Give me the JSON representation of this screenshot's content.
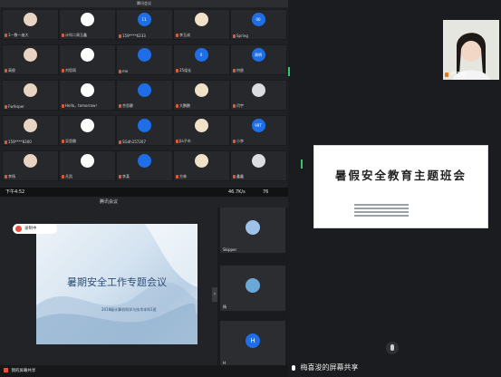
{
  "grid": {
    "title": "腾讯会议",
    "tiles": [
      {
        "label": "1—数—庞大"
      },
      {
        "label": "计科二周玉鑫"
      },
      {
        "label": "159****6233"
      },
      {
        "label": "李玉成"
      },
      {
        "label": "Spring"
      },
      {
        "label": "高俊"
      },
      {
        "label": "刘思雨"
      },
      {
        "label": "me"
      },
      {
        "label": "25组长"
      },
      {
        "label": "何俊"
      },
      {
        "label": "Fwhisper"
      },
      {
        "label": "Hello，tomorrow！"
      },
      {
        "label": "余思静"
      },
      {
        "label": "大鹏鹏"
      },
      {
        "label": "闫宇"
      },
      {
        "label": "159****8300"
      },
      {
        "label": "吴思嫩"
      },
      {
        "label": "SGdh157207"
      },
      {
        "label": "Jia子市"
      },
      {
        "label": "小李"
      },
      {
        "label": "李扬"
      },
      {
        "label": "凡凯"
      },
      {
        "label": "李某"
      },
      {
        "label": "方林"
      },
      {
        "label": "鑫鑫"
      }
    ],
    "badges": [
      "11",
      "0",
      "周明",
      "99T",
      "00"
    ]
  },
  "phone": {
    "time": "下午4:52",
    "network": "46.7K/s",
    "battery": "76",
    "app_title": "腾讯会议",
    "share_badge": "录制中",
    "slide_title": "暑期安全工作专题会议",
    "slide_subtitle": "2018级计算机科学与技术本科1班",
    "participants": [
      {
        "name": "Skipper"
      },
      {
        "name": "杨"
      },
      {
        "name": "H"
      }
    ],
    "bottom_label": "我的屏幕共享"
  },
  "right": {
    "camera_name": "代亚南",
    "card_title": "暑假安全教育主题班会",
    "footer_text": "梅喜浚的屏幕共享"
  },
  "colors": {
    "accent_blue": "#1e6ee8",
    "record_red": "#e74c3c"
  }
}
